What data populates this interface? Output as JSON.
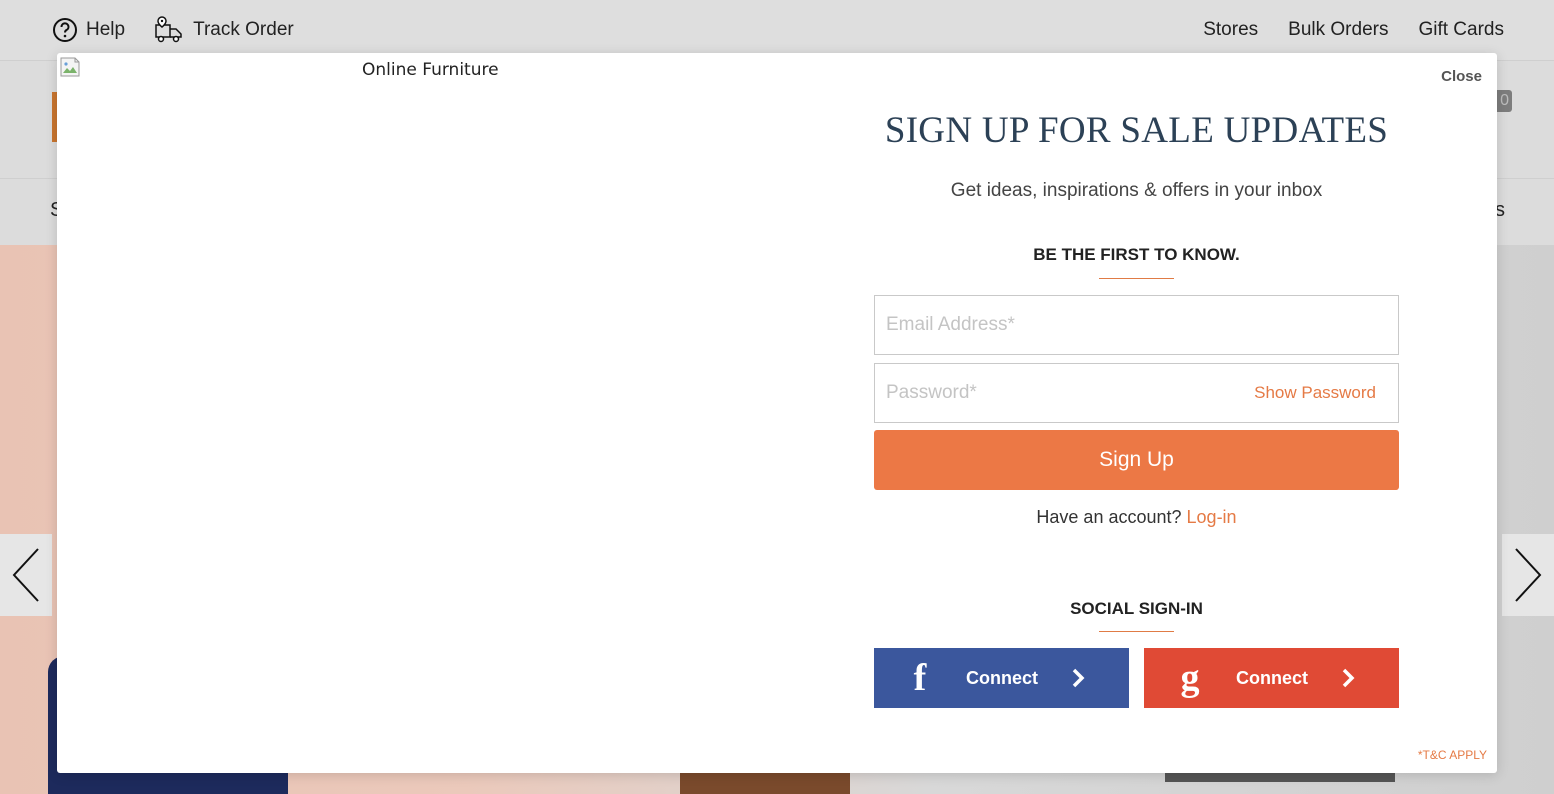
{
  "topbar": {
    "help_label": "Help",
    "track_order_label": "Track Order",
    "links": [
      "Stores",
      "Bulk Orders",
      "Gift Cards"
    ]
  },
  "header": {
    "cart_count": "0",
    "nav_fragment_left": "S",
    "nav_fragment_right": "s"
  },
  "modal": {
    "image_alt": "Online Furniture",
    "close_label": "Close",
    "title": "SIGN UP FOR SALE UPDATES",
    "subtitle": "Get ideas, inspirations & offers in your inbox",
    "first_to_know": "BE THE FIRST TO KNOW.",
    "email_placeholder": "Email Address*",
    "password_placeholder": "Password*",
    "show_password_label": "Show Password",
    "signup_label": "Sign Up",
    "have_account_text": "Have an account?",
    "login_label": "Log-in",
    "social_heading": "SOCIAL SIGN-IN",
    "facebook_icon_glyph": "f",
    "facebook_label": "Connect",
    "google_icon_glyph": "g",
    "google_label": "Connect",
    "tc_label": "*T&C APPLY"
  },
  "colors": {
    "accent": "#ec7845",
    "title": "#2c4156",
    "facebook": "#3b579d",
    "google": "#e04a35"
  }
}
